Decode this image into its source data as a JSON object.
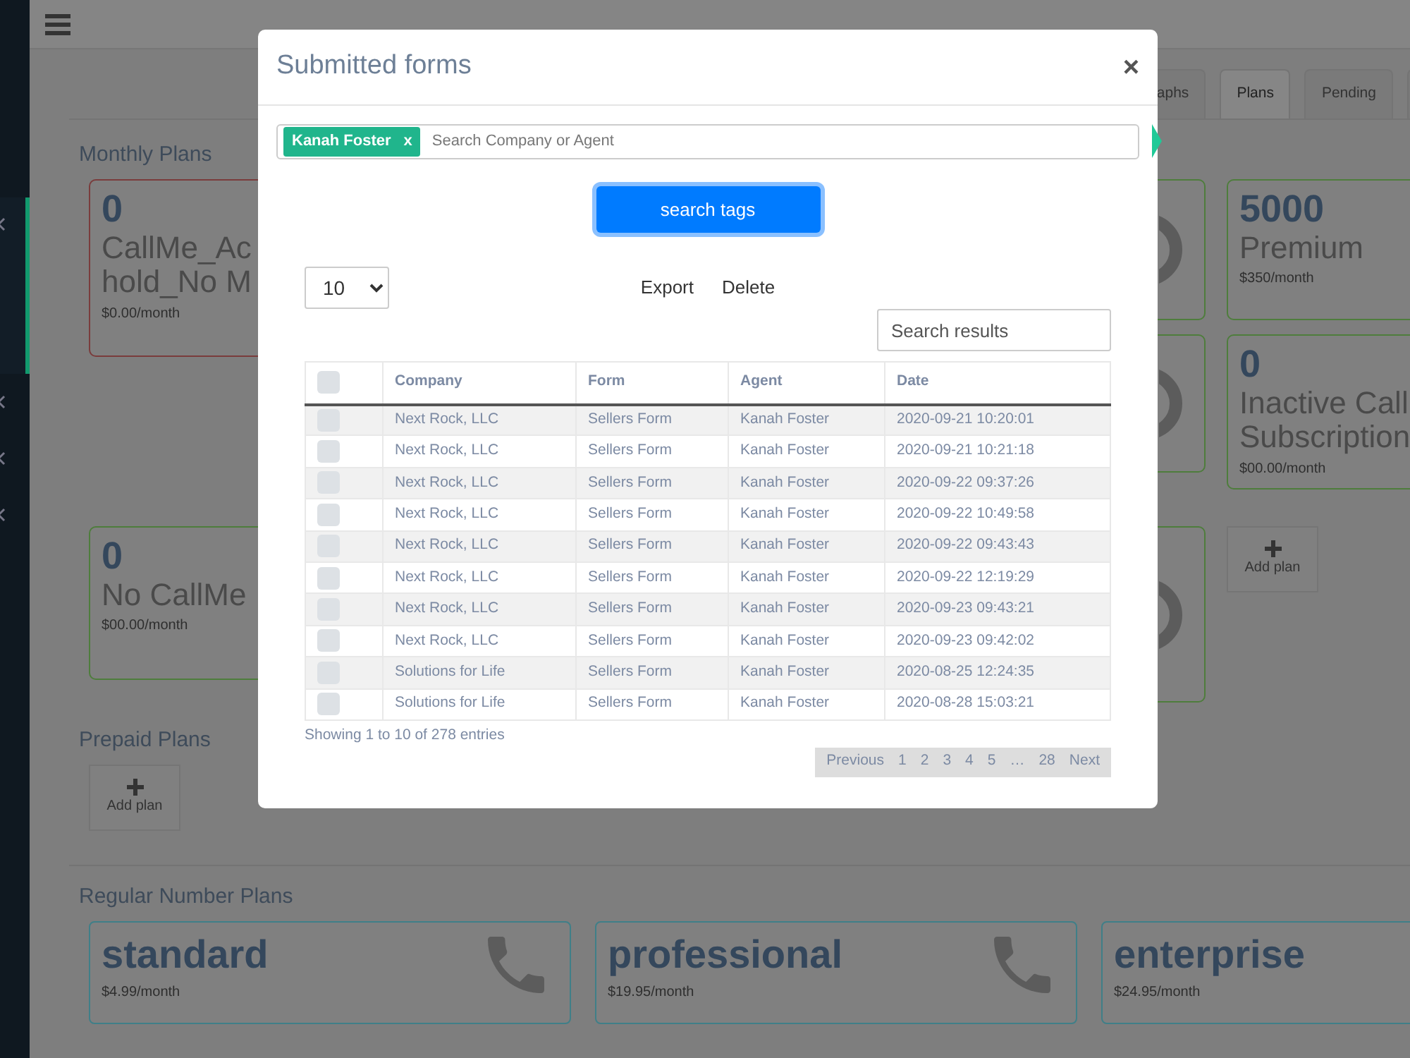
{
  "sidebar": {
    "items": [
      {
        "selected": true
      },
      {
        "selected": false
      },
      {
        "selected": false
      },
      {
        "selected": false
      }
    ]
  },
  "tabs": [
    {
      "label": "aphs",
      "selected": false
    },
    {
      "label": "Plans",
      "selected": true
    },
    {
      "label": "Pending",
      "selected": false
    }
  ],
  "monthly": {
    "title": "Monthly Plans",
    "plans": [
      {
        "kind": "count",
        "count": "0",
        "name_lines": [
          "CallMe_Ac",
          "hold_No M"
        ],
        "price": "$0.00/month",
        "color": "#7a3c3c"
      },
      {
        "kind": "covered",
        "color": "#4e7d3c"
      },
      {
        "kind": "count",
        "count": "5000",
        "name_lines": [
          "Premium"
        ],
        "price": "$350/month",
        "color": "#4e7d3c"
      },
      {
        "kind": "covered",
        "color": "#4e7d3c"
      },
      {
        "kind": "count",
        "count": "0",
        "name_lines": [
          "Inactive Call",
          "Subscription"
        ],
        "price": "$00.00/month",
        "color": "#4e7d3c"
      },
      {
        "kind": "count",
        "count": "0",
        "name_lines": [
          "No CallMe"
        ],
        "price": "$00.00/month",
        "color": "#4e7d3c"
      },
      {
        "kind": "covered",
        "color": "#4e7d3c"
      },
      {
        "kind": "add",
        "label": "Add plan"
      }
    ]
  },
  "prepaid": {
    "title": "Prepaid Plans",
    "add_label": "Add plan"
  },
  "regular": {
    "title": "Regular Number Plans",
    "plans": [
      {
        "name": "standard",
        "price": "$4.99/month"
      },
      {
        "name": "professional",
        "price": "$19.95/month"
      },
      {
        "name": "enterprise",
        "price": "$24.95/month"
      }
    ]
  },
  "modal": {
    "title": "Submitted forms",
    "close": "×",
    "tags": [
      {
        "label": "Kanah Foster",
        "remove": "x"
      }
    ],
    "search_placeholder": "Search Company or Agent",
    "search_button": "search tags",
    "page_size": "10",
    "actions": [
      "Export",
      "Delete"
    ],
    "filter_placeholder": "Search results",
    "table": {
      "all_checked": false,
      "columns": [
        "Company",
        "Form",
        "Agent",
        "Date"
      ],
      "rows": [
        {
          "checked": false,
          "cells": [
            "Next Rock, LLC",
            "Sellers Form",
            "Kanah Foster",
            "2020-09-21 10:20:01"
          ]
        },
        {
          "checked": false,
          "cells": [
            "Next Rock, LLC",
            "Sellers Form",
            "Kanah Foster",
            "2020-09-21 10:21:18"
          ]
        },
        {
          "checked": false,
          "cells": [
            "Next Rock, LLC",
            "Sellers Form",
            "Kanah Foster",
            "2020-09-22 09:37:26"
          ]
        },
        {
          "checked": false,
          "cells": [
            "Next Rock, LLC",
            "Sellers Form",
            "Kanah Foster",
            "2020-09-22 10:49:58"
          ]
        },
        {
          "checked": false,
          "cells": [
            "Next Rock, LLC",
            "Sellers Form",
            "Kanah Foster",
            "2020-09-22 09:43:43"
          ]
        },
        {
          "checked": false,
          "cells": [
            "Next Rock, LLC",
            "Sellers Form",
            "Kanah Foster",
            "2020-09-22 12:19:29"
          ]
        },
        {
          "checked": false,
          "cells": [
            "Next Rock, LLC",
            "Sellers Form",
            "Kanah Foster",
            "2020-09-23 09:43:21"
          ]
        },
        {
          "checked": false,
          "cells": [
            "Next Rock, LLC",
            "Sellers Form",
            "Kanah Foster",
            "2020-09-23 09:42:02"
          ]
        },
        {
          "checked": false,
          "cells": [
            "Solutions for Life",
            "Sellers Form",
            "Kanah Foster",
            "2020-08-25 12:24:35"
          ]
        },
        {
          "checked": false,
          "cells": [
            "Solutions for Life",
            "Sellers Form",
            "Kanah Foster",
            "2020-08-28 15:03:21"
          ]
        }
      ]
    },
    "info": "Showing 1 to 10 of 278 entries",
    "pagination": [
      "Previous",
      "1",
      "2",
      "3",
      "4",
      "5",
      "…",
      "28",
      "Next"
    ]
  }
}
